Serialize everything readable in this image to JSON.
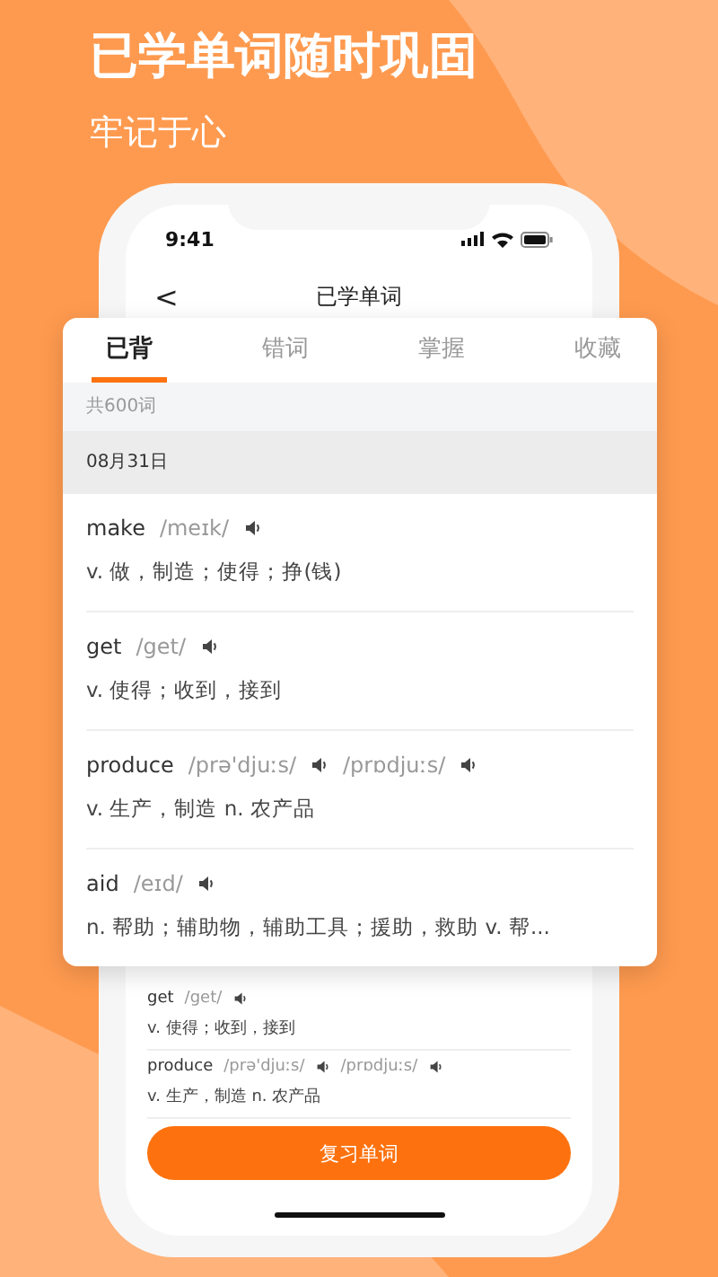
{
  "headline": "已学单词随时巩固",
  "subheadline": "牢记于心",
  "phone": {
    "time": "9:41",
    "title": "已学单词",
    "back": "<",
    "rows": [
      {
        "word": "get",
        "phonetics": [
          "/get/"
        ],
        "meaning": "v. 使得；收到，接到"
      },
      {
        "word": "produce",
        "phonetics": [
          "/prə'djuːs/",
          "/prɒdjuːs/"
        ],
        "meaning": "v. 生产，制造  n. 农产品"
      }
    ],
    "button": "复习单词"
  },
  "card": {
    "tabs": [
      {
        "label": "已背",
        "selected": true
      },
      {
        "label": "错词",
        "selected": false
      },
      {
        "label": "掌握",
        "selected": false
      },
      {
        "label": "收藏",
        "selected": false
      }
    ],
    "count": "共600词",
    "date": "08月31日",
    "words": [
      {
        "word": "make",
        "phonetics": [
          "/meɪk/"
        ],
        "meaning": "v. 做，制造；使得；挣(钱)"
      },
      {
        "word": "get",
        "phonetics": [
          "/get/"
        ],
        "meaning": "v. 使得；收到，接到"
      },
      {
        "word": "produce",
        "phonetics": [
          "/prə'djuːs/",
          "/prɒdjuːs/"
        ],
        "meaning": "v. 生产，制造  n. 农产品"
      },
      {
        "word": "aid",
        "phonetics": [
          "/eɪd/"
        ],
        "meaning": "n. 帮助；辅助物，辅助工具；援助，救助  v. 帮..."
      }
    ]
  }
}
